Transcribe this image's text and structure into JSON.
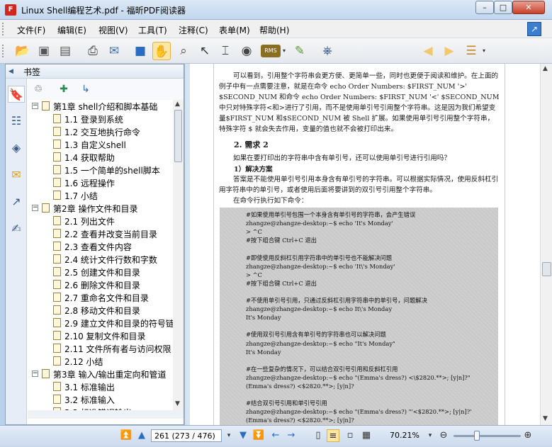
{
  "window": {
    "title": "Linux  Shell编程艺术.pdf - 福昕PDF阅读器",
    "app_icon_text": "F"
  },
  "menu": [
    "文件(F)",
    "编辑(E)",
    "视图(V)",
    "工具(T)",
    "注释(C)",
    "表单(M)",
    "帮助(H)"
  ],
  "toolbar": {
    "buttons": [
      "open-icon",
      "save-icon",
      "save-as-icon",
      "print-icon",
      "email-icon",
      "fullscreen-icon",
      "hand-icon",
      "zoom-select-icon",
      "select-arrow-icon",
      "text-select-icon",
      "snapshot-icon",
      "rms-icon",
      "sign-icon",
      "search-icon",
      "prev-result-icon",
      "next-result-icon",
      "highlight-icon"
    ],
    "rms_label": "RMS",
    "search_value": ""
  },
  "sidebar": {
    "title": "书签",
    "tabs": [
      "bookmarks-icon",
      "pages-icon",
      "layers-icon",
      "comments-icon",
      "attachments-icon",
      "signatures-icon"
    ],
    "bookmarks": [
      {
        "level": 0,
        "text": "第1章 shell介绍和脚本基础",
        "expanded": true
      },
      {
        "level": 1,
        "text": "1.1 登录到系统"
      },
      {
        "level": 1,
        "text": "1.2 交互地执行命令"
      },
      {
        "level": 1,
        "text": "1.3 自定义shell"
      },
      {
        "level": 1,
        "text": "1.4 获取帮助"
      },
      {
        "level": 1,
        "text": "1.5 一个简单的shell脚本"
      },
      {
        "level": 1,
        "text": "1.6 远程操作"
      },
      {
        "level": 1,
        "text": "1.7 小结"
      },
      {
        "level": 0,
        "text": "第2章 操作文件和目录",
        "expanded": true
      },
      {
        "level": 1,
        "text": "2.1 列出文件"
      },
      {
        "level": 1,
        "text": "2.2 查看并改变当前目录"
      },
      {
        "level": 1,
        "text": "2.3 查看文件内容"
      },
      {
        "level": 1,
        "text": "2.4 统计文件行数和字数"
      },
      {
        "level": 1,
        "text": "2.5 创建文件和目录"
      },
      {
        "level": 1,
        "text": "2.6 删除文件和目录"
      },
      {
        "level": 1,
        "text": "2.7 重命名文件和目录"
      },
      {
        "level": 1,
        "text": "2.8 移动文件和目录"
      },
      {
        "level": 1,
        "text": "2.9 建立文件和目录的符号链"
      },
      {
        "level": 1,
        "text": "2.10 复制文件和目录"
      },
      {
        "level": 1,
        "text": "2.11 文件所有者与访问权限"
      },
      {
        "level": 1,
        "text": "2.12 小结"
      },
      {
        "level": 0,
        "text": "第3章 输入/输出重定向和管道",
        "expanded": true
      },
      {
        "level": 1,
        "text": "3.1 标准输出"
      },
      {
        "level": 1,
        "text": "3.2 标准输入"
      },
      {
        "level": 1,
        "text": "3.3 标准错误输出"
      }
    ]
  },
  "document": {
    "para1": "可以看到，引用整个字符串会更方便、更简单一些，同时也更便于阅读和维护。在上面的例子中有一点需要注意，就是在命令 echo Order Numbers: $FIRST_NUM '>' $SECOND_NUM 和命令 echo Order Numbers: $FIRST_NUM '<' $SECOND_NUM 中只对特殊字符<和>进行了引用，而不是使用单引号引用整个字符串。这是因为我们希望变量$FIRST_NUM 和$SECOND_NUM 被 Shell 扩展。如果使用单引号引用整个字符串，特殊字符 $ 就会失去作用，变量的值也就不会被打印出来。",
    "heading": "2.  需求 2",
    "para2": "如果在要打印出的字符串中含有单引号，还可以使用单引号进行引用吗？",
    "sub": "1）解决方案",
    "para3": "答案是不能使用单引号引用本身含有单引号的字符串。可以根据实际情况，使用反斜杠引用字符串中的单引号，或者使用后面将要讲到的双引号引用整个字符串。",
    "para4": "在命令行执行如下命令：",
    "code": [
      "#如果使用单引号包围一个本身含有单引号的字符串，会产生错误",
      "zhangze@zhangze-desktop:~$ echo 'It's Monday'",
      "> ^C",
      "#按下组合键 Ctrl+C 退出",
      "",
      "#即使使用反斜杠引用字符串中的单引号也不能解决问题",
      "zhangze@zhangze-desktop:~$ echo 'It\\'s Monday'",
      "> ^C",
      "#按下组合键 Ctrl+C 退出",
      "",
      "#不使用单引号引用，只通过反斜杠引用字符串中的单引号，问题解决",
      "zhangze@zhangze-desktop:~$ echo It\\'s Monday",
      "It's Monday",
      "",
      "#使用双引号引用含有单引号的字符串也可以解决问题",
      "zhangze@zhangze-desktop:~$ echo \"It's Monday\"",
      "It's Monday",
      "",
      "#在一些复杂的情况下，可以结合双引号引用和反斜杠引用",
      "zhangze@zhangze-desktop:~$ echo \"(Emma's dress?) <\\$2820.**>; [y|n]?\"",
      "(Emma's dress?) <$2820.**>; [y|n]?",
      "",
      "#结合双引号引用和单引号引用",
      "zhangze@zhangze-desktop:~$ echo \"(Emma's dress?) \"'<$2820.**>; [y|n]?'",
      "(Emma's dress?) <$2820.**>; [y|n]?"
    ]
  },
  "statusbar": {
    "page_value": "261 (273 / 476)",
    "zoom": "70.21%",
    "zoom_fraction": 0.35
  }
}
